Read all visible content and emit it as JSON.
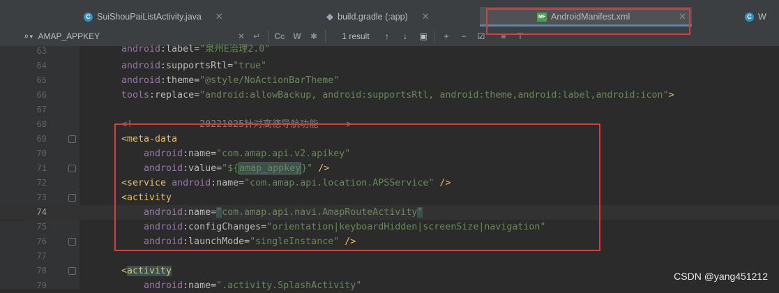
{
  "tabs": [
    {
      "label": "SuiShouPaiListActivity.java",
      "icon": "java-class-icon"
    },
    {
      "label": "build.gradle (:app)",
      "icon": "gradle-elephant-icon"
    },
    {
      "label": "AndroidManifest.xml",
      "icon": "xml-manifest-icon"
    },
    {
      "label": "W",
      "icon": "java-class-icon"
    }
  ],
  "active_tab": "AndroidManifest.xml",
  "search": {
    "query": "AMAP_APPKEY",
    "result_count": "1 result",
    "case_button": "Cc",
    "word_button": "W"
  },
  "code_lines": [
    {
      "num": "63"
    },
    {
      "num": "64"
    },
    {
      "num": "65"
    },
    {
      "num": "66"
    },
    {
      "num": "67"
    },
    {
      "num": "68"
    },
    {
      "num": "69"
    },
    {
      "num": "70"
    },
    {
      "num": "71"
    },
    {
      "num": "72"
    },
    {
      "num": "73"
    },
    {
      "num": "74"
    },
    {
      "num": "75"
    },
    {
      "num": "76"
    },
    {
      "num": "77"
    },
    {
      "num": "78"
    },
    {
      "num": "79"
    }
  ],
  "code": {
    "l63_label": "\"泉州E治理2.0\"",
    "l64_val": "\"true\"",
    "l65_val": "\"@style/NoActionBarTheme\"",
    "l66_val": "\"android:allowBackup, android:supportsRtl, android:theme,android:label,android:icon\"",
    "l68_comment": "<!--          20221025针对高德导航功能   -->",
    "l70_val": "\"com.amap.api.v2.apikey\"",
    "l71_prefix": "\"${",
    "l71_key": "amap_appkey",
    "l71_suffix": "}\"",
    "l72_val": "\"com.amap.api.location.APSService\"",
    "l74_val": "com.amap.api.navi.AmapRouteActivity",
    "l75_val": "\"orientation|keyboardHidden|screenSize|navigation\"",
    "l76_val": "\"singleInstance\"",
    "l79_val": "\".activity.SplashActivity\""
  },
  "watermark": "CSDN @yang451212"
}
